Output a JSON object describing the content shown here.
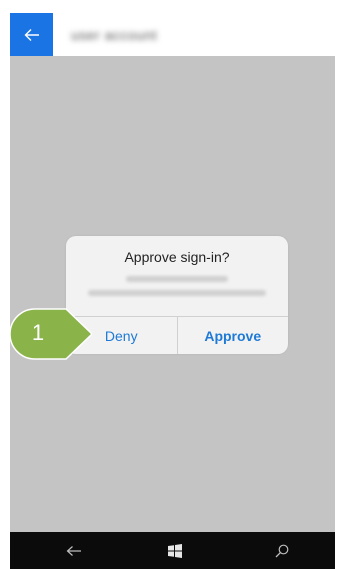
{
  "header": {
    "back_icon": "arrow-left-icon",
    "account_name": "user account"
  },
  "dialog": {
    "title": "Approve sign-in?",
    "deny_label": "Deny",
    "approve_label": "Approve"
  },
  "annotation": {
    "step": "1"
  },
  "nav_bar": {
    "back_icon": "arrow-left-icon",
    "start_icon": "windows-logo-icon",
    "search_icon": "search-icon"
  },
  "colors": {
    "accent": "#1b74e4",
    "link": "#1e7ad6",
    "overlay": "#c4c4c4",
    "marker": "#8ab34a",
    "nav_bar": "#0b0b0b"
  }
}
